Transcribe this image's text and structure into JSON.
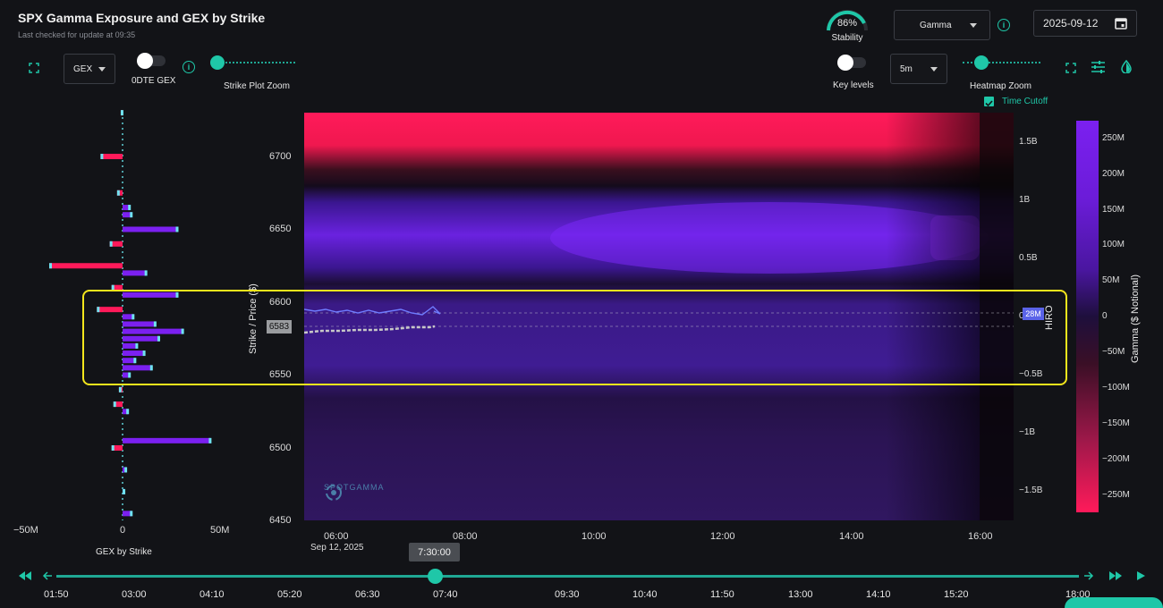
{
  "header": {
    "title": "SPX Gamma Exposure and GEX by Strike",
    "subtitle": "Last checked for update at 09:35"
  },
  "stability": {
    "percent_label": "86%",
    "label": "Stability",
    "value": 0.86
  },
  "measure_select": {
    "value": "Gamma"
  },
  "date_input": {
    "value": "2025-09-12"
  },
  "left_toolbar": {
    "gex_select": "GEX",
    "odte_label": "0DTE GEX",
    "strike_zoom_label": "Strike Plot Zoom"
  },
  "right_toolbar": {
    "key_levels_label": "Key levels",
    "interval_select": "5m",
    "heatmap_zoom_label": "Heatmap Zoom",
    "time_cutoff_label": "Time Cutoff"
  },
  "icons": {
    "expand": "expand-icon",
    "info": "info-icon",
    "calendar": "calendar-icon",
    "settings": "sliders-icon",
    "color": "droplet-icon"
  },
  "colors": {
    "accent": "#1fc7a8",
    "positive": "#7b20f0",
    "negative": "#ff1a5a",
    "highlight": "#f4e61c"
  },
  "gex_chart": {
    "xlabel": "GEX by Strike",
    "x_ticks": [
      "−50M",
      "0",
      "50M"
    ]
  },
  "chart_data": {
    "type": "heatmap",
    "y_axis_label": "Strike / Price ($)",
    "y_ticks": [
      "6700",
      "6650",
      "6600",
      "6550",
      "6500",
      "6450"
    ],
    "current_price_label": "6583",
    "x_ticks": [
      "06:00",
      "08:00",
      "10:00",
      "12:00",
      "14:00",
      "16:00"
    ],
    "date_label": "Sep 12, 2025",
    "hiro_ticks": [
      "1.5B",
      "1B",
      "0.5B",
      "0",
      "−0.5B",
      "−1B",
      "−1.5B"
    ],
    "hiro_label": "HIRO",
    "hiro_value_label": "28M",
    "colorbar_label": "Gamma ($ Notional)",
    "colorbar_ticks": [
      "250M",
      "200M",
      "150M",
      "100M",
      "50M",
      "0",
      "−50M",
      "−100M",
      "−150M",
      "−200M",
      "−250M"
    ],
    "watermark": "SPOTGAMMA",
    "gex_bars": [
      {
        "strike": 6730,
        "value": -1
      },
      {
        "strike": 6700,
        "value": -12
      },
      {
        "strike": 6675,
        "value": -3
      },
      {
        "strike": 6665,
        "value": 4
      },
      {
        "strike": 6660,
        "value": 5
      },
      {
        "strike": 6650,
        "value": 30
      },
      {
        "strike": 6640,
        "value": -7
      },
      {
        "strike": 6625,
        "value": -40
      },
      {
        "strike": 6620,
        "value": 13
      },
      {
        "strike": 6610,
        "value": -6
      },
      {
        "strike": 6605,
        "value": 30
      },
      {
        "strike": 6595,
        "value": -14
      },
      {
        "strike": 6590,
        "value": 6
      },
      {
        "strike": 6585,
        "value": 18
      },
      {
        "strike": 6580,
        "value": 33
      },
      {
        "strike": 6575,
        "value": 20
      },
      {
        "strike": 6570,
        "value": 8
      },
      {
        "strike": 6565,
        "value": 12
      },
      {
        "strike": 6560,
        "value": 7
      },
      {
        "strike": 6555,
        "value": 16
      },
      {
        "strike": 6550,
        "value": 4
      },
      {
        "strike": 6540,
        "value": -2
      },
      {
        "strike": 6530,
        "value": -5
      },
      {
        "strike": 6525,
        "value": 3
      },
      {
        "strike": 6505,
        "value": 48
      },
      {
        "strike": 6500,
        "value": -6
      },
      {
        "strike": 6485,
        "value": 2
      },
      {
        "strike": 6470,
        "value": 1
      },
      {
        "strike": 6455,
        "value": 5
      }
    ],
    "hiro_line": [
      {
        "t": "05:40",
        "v": 0.02
      },
      {
        "t": "06:00",
        "v": 0.03
      },
      {
        "t": "06:20",
        "v": 0.0
      },
      {
        "t": "06:40",
        "v": 0.05
      },
      {
        "t": "07:00",
        "v": 0.01
      },
      {
        "t": "07:10",
        "v": 0.05
      },
      {
        "t": "07:20",
        "v": 0.03
      },
      {
        "t": "07:30",
        "v": 0.06
      },
      {
        "t": "07:40",
        "v": 0.01
      }
    ]
  },
  "timeline": {
    "labels": [
      "01:50",
      "03:00",
      "04:10",
      "05:20",
      "06:30",
      "07:40",
      "09:30",
      "10:40",
      "11:50",
      "13:00",
      "14:10",
      "15:20",
      "18:00"
    ],
    "current": "7:30:00",
    "progress": 0.37
  }
}
